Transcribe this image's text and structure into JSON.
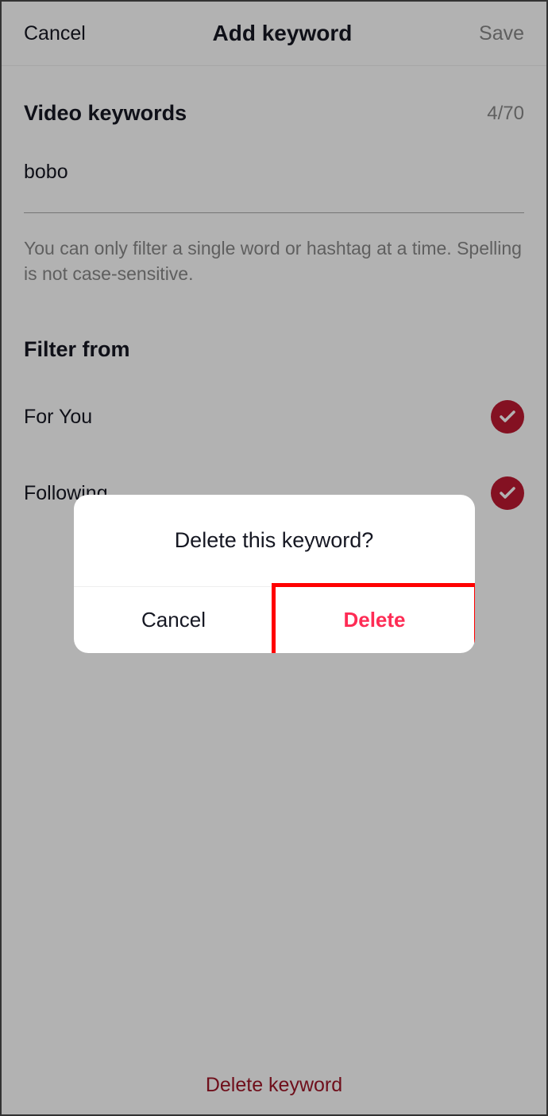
{
  "header": {
    "cancel_label": "Cancel",
    "title": "Add keyword",
    "save_label": "Save"
  },
  "video_keywords": {
    "section_title": "Video keywords",
    "counter": "4/70",
    "value": "bobo",
    "help_text": "You can only filter a single word or hashtag at a time. Spelling is not case-sensitive."
  },
  "filter_from": {
    "section_title": "Filter from",
    "options": [
      {
        "label": "For You",
        "checked": true
      },
      {
        "label": "Following",
        "checked": true
      }
    ]
  },
  "footer": {
    "delete_label": "Delete keyword"
  },
  "dialog": {
    "title": "Delete this keyword?",
    "cancel_label": "Cancel",
    "delete_label": "Delete"
  },
  "colors": {
    "accent": "#be1931",
    "destructive": "#fe2c55"
  }
}
